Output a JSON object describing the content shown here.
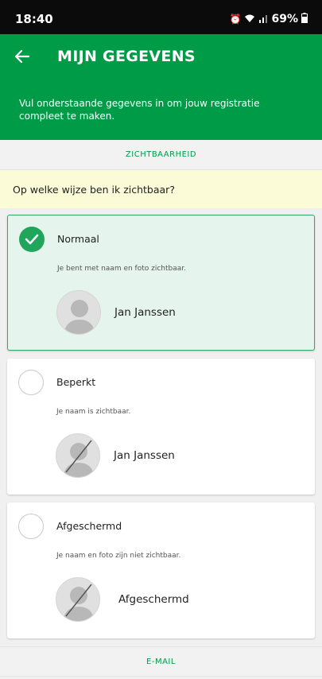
{
  "status_bar": {
    "time": "18:40",
    "battery": "69%",
    "icons": [
      "alarm-icon",
      "wifi-icon",
      "signal-icon",
      "battery-icon"
    ]
  },
  "app_bar": {
    "title": "MIJN GEGEVENS",
    "back_icon": "arrow-left-icon"
  },
  "intro": {
    "text": "Vul onderstaande gegevens in om jouw registratie compleet te maken."
  },
  "sections": {
    "visibility": "ZICHTBAARHEID",
    "email": "E-MAIL"
  },
  "question": "Op welke wijze ben ik zichtbaar?",
  "options": [
    {
      "title": "Normaal",
      "description": "Je bent met naam en foto zichtbaar.",
      "name": "Jan Janssen",
      "selected": true
    },
    {
      "title": "Beperkt",
      "description": "Je naam is zichtbaar.",
      "name": "Jan Janssen",
      "selected": false
    },
    {
      "title": "Afgeschermd",
      "description": "Je naam en foto zijn niet zichtbaar.",
      "name": "Afgeschermd",
      "selected": false
    }
  ],
  "colors": {
    "brand_green": "#009b47",
    "selected_bg": "#e5f4ec",
    "question_bg": "#fbfbd7"
  }
}
